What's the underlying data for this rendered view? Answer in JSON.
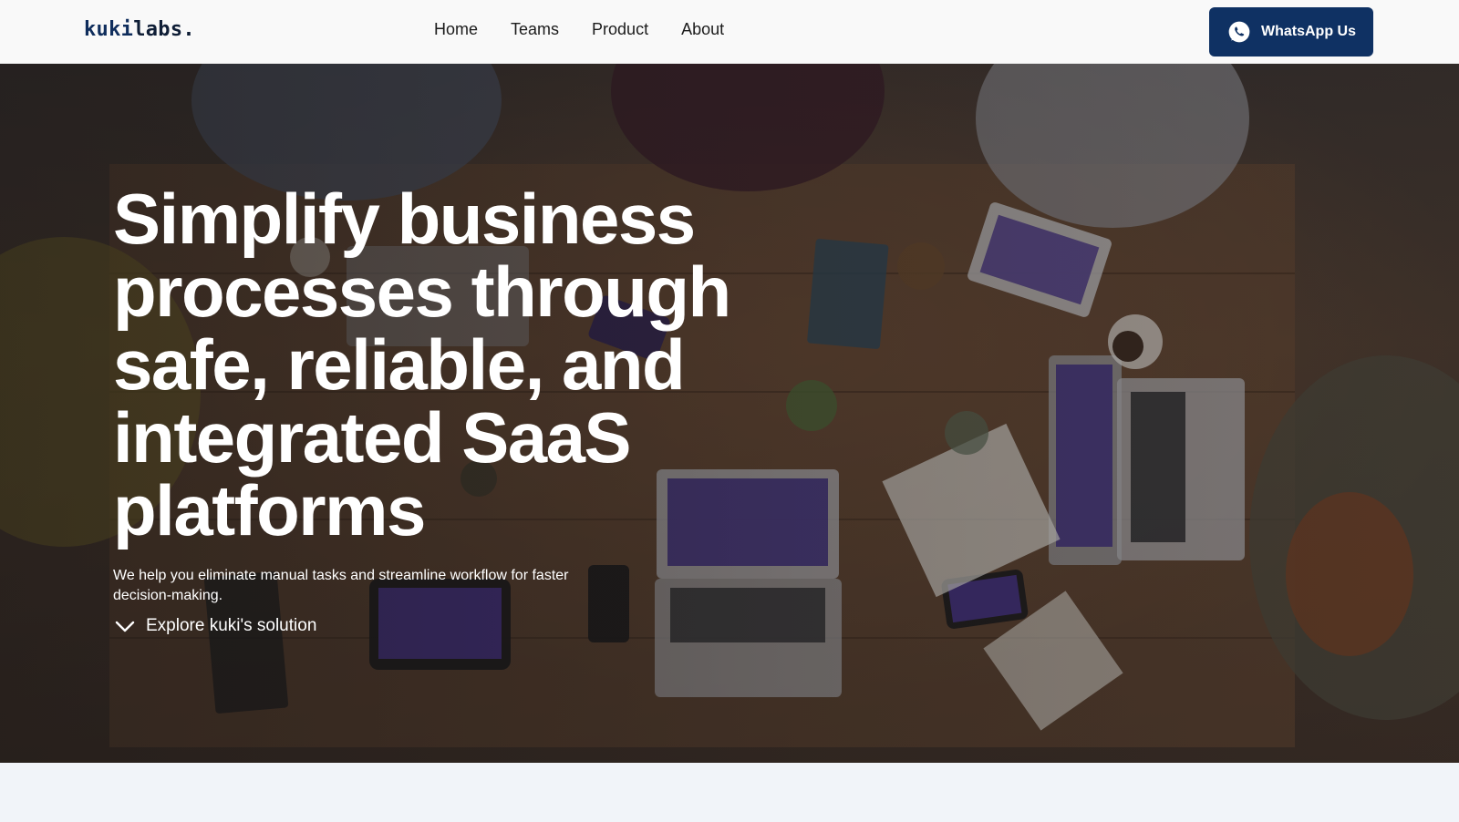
{
  "brand": {
    "logo_prefix": "kuki",
    "logo_suffix": "labs."
  },
  "nav": {
    "links": [
      "Home",
      "Teams",
      "Product",
      "About"
    ],
    "cta_label": "WhatsApp Us"
  },
  "hero": {
    "title": "Simplify business processes through safe, reliable, and integrated SaaS platforms",
    "subtitle": "We help you eliminate manual tasks and streamline workflow for faster decision-making.",
    "explore_label": "Explore kuki's solution"
  },
  "colors": {
    "brand_navy": "#0f3163",
    "nav_bg": "#f9f9f9",
    "page_bg": "#f1f4f9",
    "hero_text": "#ffffff"
  },
  "icons": {
    "cta_icon": "whatsapp-icon",
    "explore_icon": "chevron-down-icon"
  }
}
